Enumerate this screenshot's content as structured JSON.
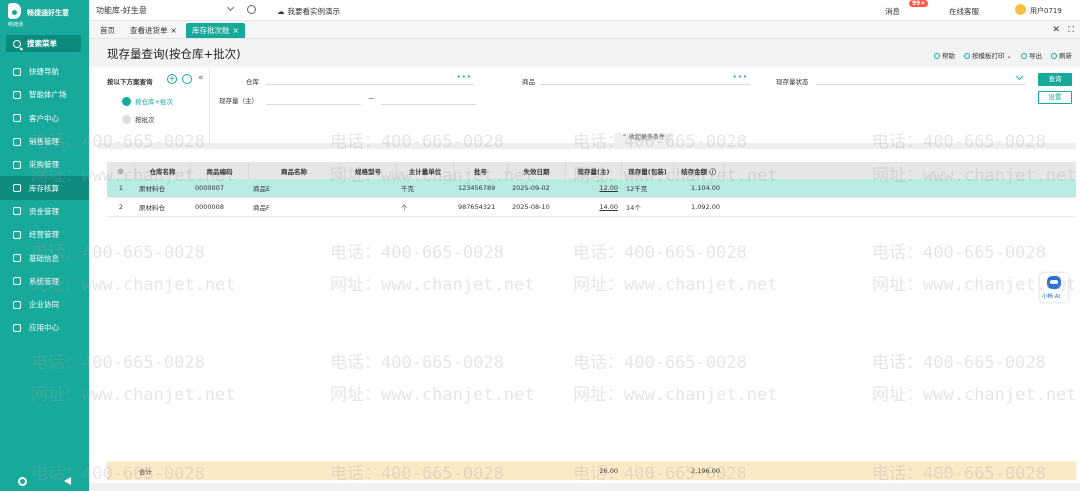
{
  "sidebar": {
    "logo_text": "畅捷通好生意",
    "logo_sub": "畅捷通",
    "search_label": "搜索菜单",
    "items": [
      {
        "label": "快捷导航"
      },
      {
        "label": "智能体广场"
      },
      {
        "label": "客户中心"
      },
      {
        "label": "销售管理"
      },
      {
        "label": "采购管理"
      },
      {
        "label": "库存核算",
        "active": true
      },
      {
        "label": "资金管理"
      },
      {
        "label": "经营管理"
      },
      {
        "label": "基础信息"
      },
      {
        "label": "系统管理"
      },
      {
        "label": "企业协同"
      },
      {
        "label": "应用中心"
      }
    ]
  },
  "topbar": {
    "func_lib": "功能库-好生意",
    "demo": "我要看实例演示",
    "messages": "消息",
    "badge": "99+",
    "service": "在线客服",
    "user": "用户0719"
  },
  "tabs": [
    {
      "label": "首页",
      "closable": false
    },
    {
      "label": "查看进货单",
      "closable": true
    },
    {
      "label": "库存批次账",
      "closable": true,
      "active": true
    }
  ],
  "page": {
    "title": "现存量查询(按仓库+批次)",
    "actions": [
      "帮助",
      "按模板打印",
      "导出",
      "刷新"
    ]
  },
  "filter": {
    "plan_title": "按以下方案查询",
    "plans": [
      {
        "label": "按仓库+批次",
        "active": true
      },
      {
        "label": "按批次",
        "active": false
      }
    ],
    "warehouse_label": "仓库",
    "product_label": "商品",
    "stock_status_label": "现存量状态",
    "qty_label": "现存量（主）",
    "range_sep": "—",
    "query_button": "查询",
    "settings_button": "设置",
    "collapse_label": "收起更多条件"
  },
  "table": {
    "columns": [
      "仓库名称",
      "商品编码",
      "商品名称",
      "规格型号",
      "主计量单位",
      "批号",
      "失效日期",
      "现存量(主)",
      "现存量(包装)",
      "结存金额"
    ],
    "rows": [
      {
        "no": "1",
        "warehouse": "原材料仓",
        "code": "0000007",
        "name": "商品E",
        "spec": "",
        "unit": "千克",
        "batch": "123456789",
        "expiry": "2025-09-02",
        "qty": "12.00",
        "qty_pack": "12千克",
        "amount": "1,104.00"
      },
      {
        "no": "2",
        "warehouse": "原材料仓",
        "code": "0000008",
        "name": "商品F",
        "spec": "",
        "unit": "个",
        "batch": "987654321",
        "expiry": "2025-08-10",
        "qty": "14.00",
        "qty_pack": "14个",
        "amount": "1,092.00"
      }
    ],
    "footer": {
      "label": "合计",
      "qty_total": "26.00",
      "amount_total": "2,196.00"
    }
  },
  "ai": {
    "label": "小畅 AI"
  },
  "watermark": {
    "phone": "电话：400-665-0028",
    "site": "网址：www.chanjet.net"
  },
  "colors": {
    "accent": "#17a99a",
    "selected_row": "#b9ebe5",
    "footer": "#fbeac6"
  }
}
